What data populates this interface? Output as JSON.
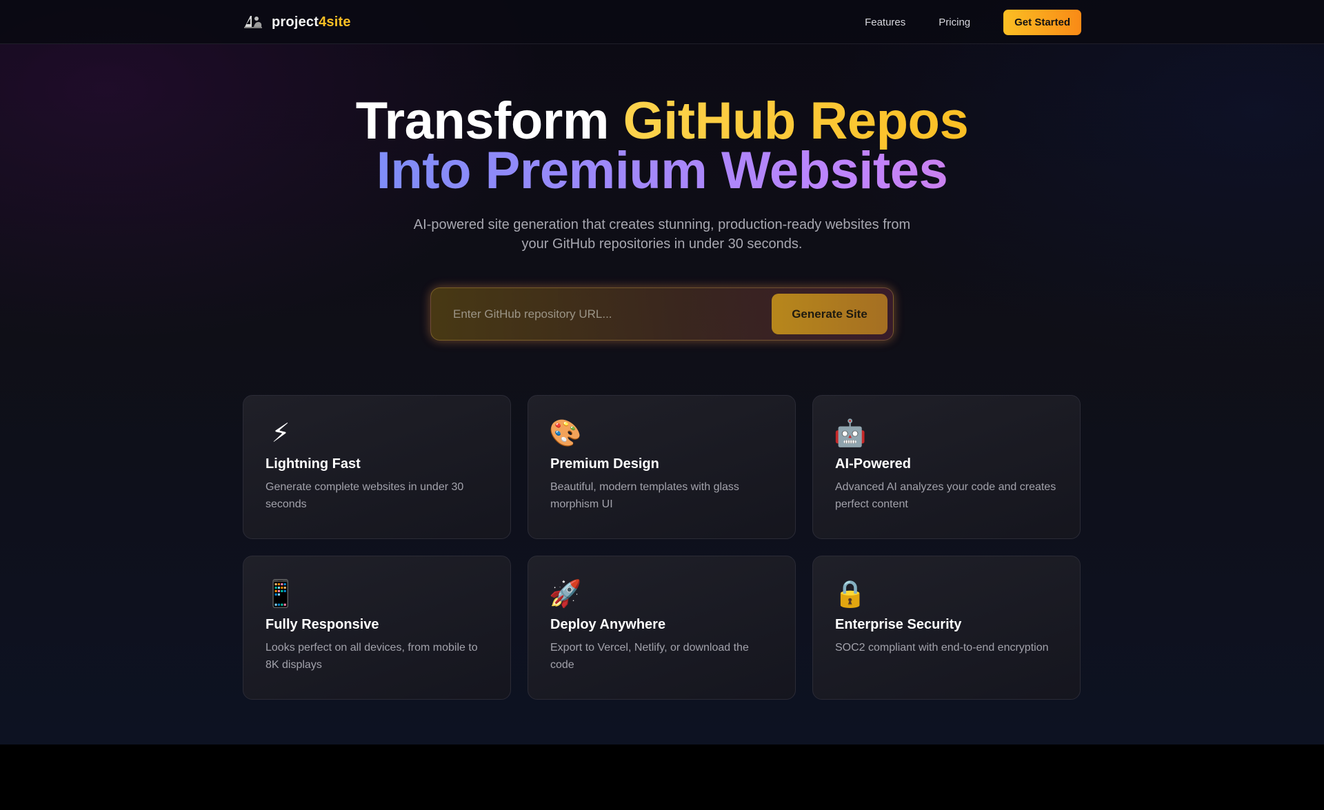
{
  "nav": {
    "brand_part1": "project",
    "brand_part2": "4site",
    "logo_icon": "project4site-logo-icon",
    "links": [
      "Features",
      "Pricing"
    ],
    "cta_label": "Get Started"
  },
  "hero": {
    "title_line1_white": "Transform",
    "title_line1_gold": "GitHub Repos",
    "title_line2": "Into Premium Websites",
    "subtitle": "AI-powered site generation that creates stunning, production-ready websites from your GitHub repositories in under 30 seconds."
  },
  "search": {
    "placeholder": "Enter GitHub repository URL...",
    "value": "",
    "button_label": "Generate Site"
  },
  "features": [
    {
      "icon": "⚡",
      "icon_name": "lightning-icon",
      "title": "Lightning Fast",
      "description": "Generate complete websites in under 30 seconds"
    },
    {
      "icon": "🎨",
      "icon_name": "palette-icon",
      "title": "Premium Design",
      "description": "Beautiful, modern templates with glass morphism UI"
    },
    {
      "icon": "🤖",
      "icon_name": "robot-icon",
      "title": "AI-Powered",
      "description": "Advanced AI analyzes your code and creates perfect content"
    },
    {
      "icon": "📱",
      "icon_name": "mobile-phone-icon",
      "title": "Fully Responsive",
      "description": "Looks perfect on all devices, from mobile to 8K displays"
    },
    {
      "icon": "🚀",
      "icon_name": "rocket-icon",
      "title": "Deploy Anywhere",
      "description": "Export to Vercel, Netlify, or download the code"
    },
    {
      "icon": "🔒",
      "icon_name": "lock-icon",
      "title": "Enterprise Security",
      "description": "SOC2 compliant with end-to-end encryption"
    }
  ],
  "colors": {
    "accent_gold": "#fbbf24",
    "accent_orange": "#f98a16",
    "gradient_blue": "#60a5fa",
    "gradient_purple": "#c084fc",
    "gradient_pink": "#f472b6"
  }
}
